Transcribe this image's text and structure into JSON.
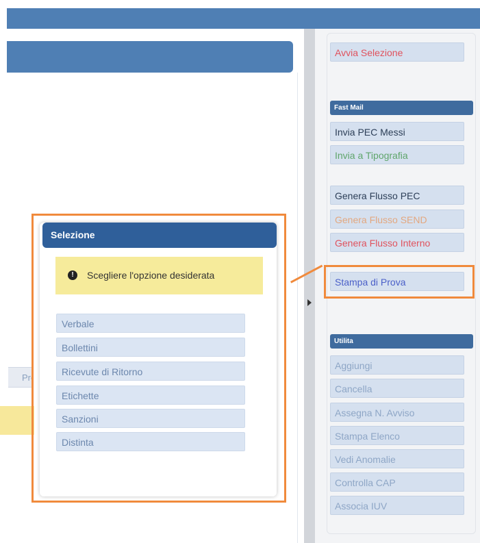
{
  "left_panel": {
    "tab_fragment": "Pro"
  },
  "right_panel": {
    "top_button": {
      "label": "Avvia Selezione",
      "color": "#e0525d"
    },
    "fast_mail": {
      "header": "Fast Mail",
      "items": [
        {
          "label": "Invia PEC Messi",
          "color": "#2c3e57"
        },
        {
          "label": "Invia a Tipografia",
          "color": "#5fa56b"
        }
      ]
    },
    "flussi": [
      {
        "label": "Genera Flusso PEC",
        "color": "#2c3e57"
      },
      {
        "label": "Genera Flusso SEND",
        "color": "#e3a77f"
      },
      {
        "label": "Genera Flusso Interno",
        "color": "#e0525d"
      }
    ],
    "stampa_prova": {
      "label": "Stampa di Prova",
      "color": "#4a5fc8"
    },
    "utilita": {
      "header": "Utilita",
      "items": [
        {
          "label": "Aggiungi"
        },
        {
          "label": "Cancella"
        },
        {
          "label": "Assegna N. Avviso"
        },
        {
          "label": "Stampa Elenco"
        },
        {
          "label": "Vedi Anomalie"
        },
        {
          "label": "Controlla CAP"
        },
        {
          "label": "Associa IUV"
        }
      ]
    }
  },
  "dialog": {
    "title": "Selezione",
    "alert_text": "Scegliere l'opzione desiderata",
    "alert_icon": "exclamation-circle-icon",
    "options": [
      {
        "label": "Verbale"
      },
      {
        "label": "Bollettini"
      },
      {
        "label": "Ricevute di Ritorno"
      },
      {
        "label": "Etichette"
      },
      {
        "label": "Sanzioni"
      },
      {
        "label": "Distinta"
      }
    ]
  },
  "highlight_color": "#f08a3c"
}
